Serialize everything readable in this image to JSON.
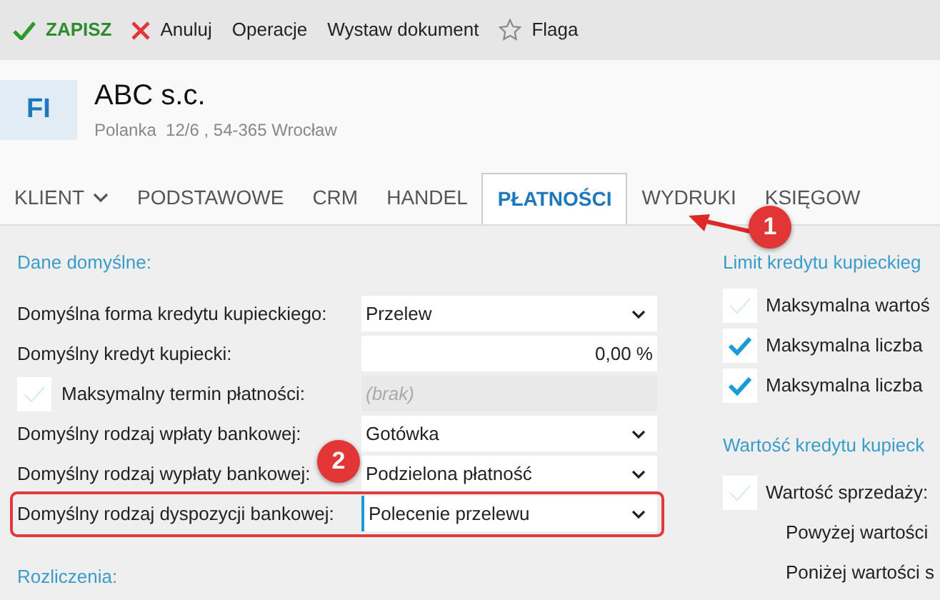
{
  "toolbar": [
    {
      "kind": "save",
      "label": "ZAPISZ"
    },
    {
      "kind": "cancel",
      "label": "Anuluj"
    },
    {
      "kind": "plain",
      "label": "Operacje"
    },
    {
      "kind": "plain",
      "label": "Wystaw dokument"
    },
    {
      "kind": "flag",
      "label": "Flaga"
    }
  ],
  "header": {
    "avatar": "FI",
    "name": "ABC s.c.",
    "address": "Polanka  12/6 , 54-365 Wrocław"
  },
  "tabs": [
    {
      "label": "KLIENT",
      "dropdown": true,
      "selected": false
    },
    {
      "label": "PODSTAWOWE",
      "dropdown": false,
      "selected": false
    },
    {
      "label": "CRM",
      "dropdown": false,
      "selected": false
    },
    {
      "label": "HANDEL",
      "dropdown": false,
      "selected": false
    },
    {
      "label": "PŁATNOŚCI",
      "dropdown": false,
      "selected": true
    },
    {
      "label": "WYDRUKI",
      "dropdown": false,
      "selected": false
    },
    {
      "label": "KSIĘGOW",
      "dropdown": false,
      "selected": false
    }
  ],
  "left": {
    "section": "Dane domyślne:",
    "rows": [
      {
        "kind": "select",
        "label": "Domyślna forma kredytu kupieckiego:",
        "value": "Przelew",
        "highlighted": false
      },
      {
        "kind": "number",
        "label": "Domyślny kredyt kupiecki:",
        "value": "0,00 %",
        "highlighted": false
      },
      {
        "kind": "check",
        "label": "Maksymalny termin płatności:",
        "checked": false,
        "placeholder": "(brak)",
        "highlighted": false
      },
      {
        "kind": "select",
        "label": "Domyślny rodzaj wpłaty bankowej:",
        "value": "Gotówka",
        "highlighted": false
      },
      {
        "kind": "select",
        "label": "Domyślny rodzaj wypłaty bankowej:",
        "value": "Podzielona płatność",
        "highlighted": false
      },
      {
        "kind": "select",
        "label": "Domyślny rodzaj dyspozycji bankowej:",
        "value": "Polecenie przelewu",
        "highlighted": true
      }
    ],
    "section2": "Rozliczenia:"
  },
  "right": {
    "sections": [
      {
        "title": "Limit kredytu kupieckieg",
        "rows": [
          {
            "kind": "check",
            "label": "Maksymalna wartoś",
            "checked": false
          },
          {
            "kind": "check",
            "label": "Maksymalna liczba",
            "checked": true
          },
          {
            "kind": "check",
            "label": "Maksymalna liczba",
            "checked": true
          }
        ]
      },
      {
        "title": "Wartość kredytu kupieck",
        "rows": [
          {
            "kind": "check",
            "label": "Wartość sprzedaży:",
            "checked": false
          },
          {
            "kind": "text",
            "label": "Powyżej wartości"
          },
          {
            "kind": "text",
            "label": "Poniżej wartości s"
          }
        ]
      }
    ]
  },
  "callouts": [
    {
      "number": "1"
    },
    {
      "number": "2"
    }
  ]
}
